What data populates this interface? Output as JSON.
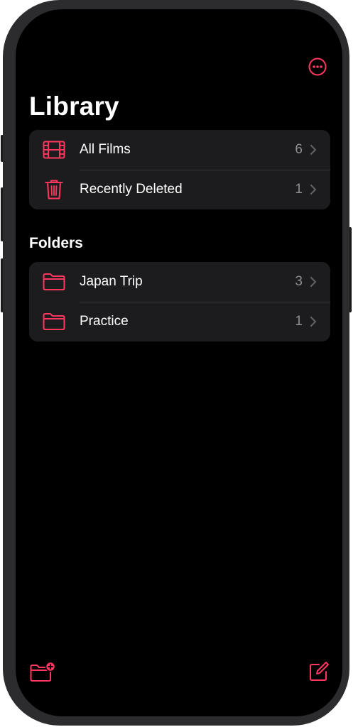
{
  "theme": {
    "accent": "#ff375f",
    "background": "#000000",
    "row_background": "#1c1c1e",
    "secondary_text": "#8e8e93"
  },
  "header": {
    "more_icon": "ellipsis-circle-icon",
    "title": "Library"
  },
  "library": {
    "items": [
      {
        "label": "All Films",
        "count": "6",
        "icon": "film-icon"
      },
      {
        "label": "Recently Deleted",
        "count": "1",
        "icon": "trash-icon"
      }
    ]
  },
  "folders": {
    "header": "Folders",
    "items": [
      {
        "label": "Japan Trip",
        "count": "3",
        "icon": "folder-icon"
      },
      {
        "label": "Practice",
        "count": "1",
        "icon": "folder-icon"
      }
    ]
  },
  "toolbar": {
    "new_folder_icon": "folder-badge-plus-icon",
    "compose_icon": "square-and-pencil-icon"
  }
}
